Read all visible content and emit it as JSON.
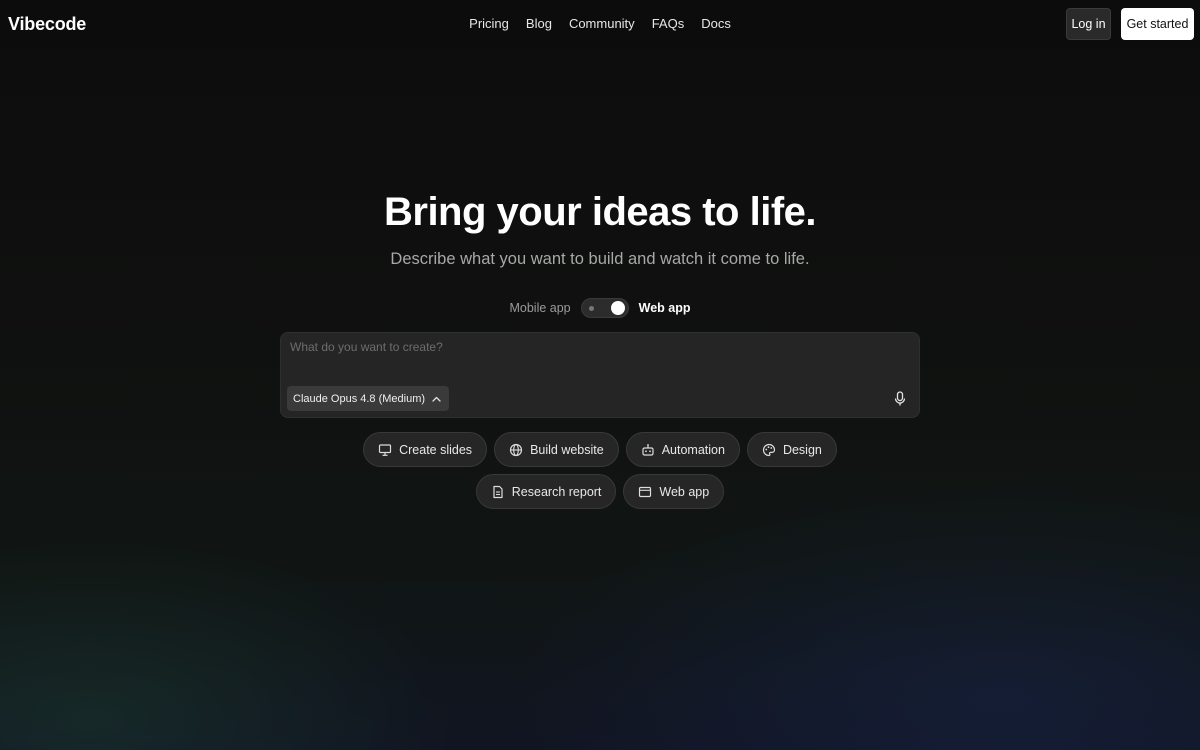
{
  "header": {
    "logo": "Vibecode",
    "nav": [
      "Pricing",
      "Blog",
      "Community",
      "FAQs",
      "Docs"
    ],
    "login_label": "Log in",
    "get_started_label": "Get started"
  },
  "hero": {
    "title": "Bring your ideas to life.",
    "subtitle": "Describe what you want to build and watch it come to life."
  },
  "mode_toggle": {
    "left_label": "Mobile app",
    "right_label": "Web app",
    "selected": "Web app"
  },
  "prompt": {
    "placeholder": "What do you want to create?",
    "value": "",
    "model_label": "Claude Opus 4.8 (Medium)"
  },
  "chips_row1": [
    {
      "label": "Create slides",
      "icon": "presentation-icon"
    },
    {
      "label": "Build website",
      "icon": "globe-icon"
    },
    {
      "label": "Automation",
      "icon": "robot-icon"
    },
    {
      "label": "Design",
      "icon": "palette-icon"
    }
  ],
  "chips_row2": [
    {
      "label": "Research report",
      "icon": "document-icon"
    },
    {
      "label": "Web app",
      "icon": "browser-window-icon"
    }
  ],
  "colors": {
    "background": "#0c0c0c",
    "prompt_bg": "#252525",
    "chip_bg": "#262626",
    "primary_button": "#ffffff"
  }
}
